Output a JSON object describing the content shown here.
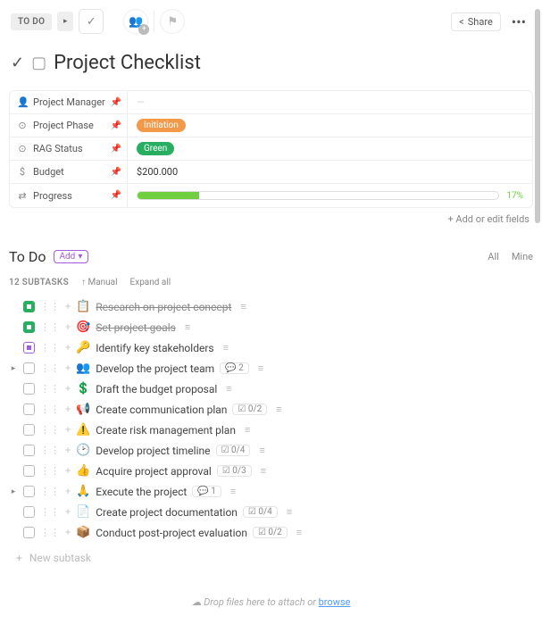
{
  "topbar": {
    "status": "TO DO",
    "share": "Share"
  },
  "page": {
    "title": "Project Checklist"
  },
  "fields": [
    {
      "icon": "👤",
      "label": "Project Manager",
      "kind": "empty",
      "value": ""
    },
    {
      "icon": "⊙",
      "label": "Project Phase",
      "kind": "tag",
      "tagClass": "orange",
      "value": "Initiation"
    },
    {
      "icon": "⊙",
      "label": "RAG Status",
      "kind": "tag",
      "tagClass": "green",
      "value": "Green"
    },
    {
      "icon": "$",
      "label": "Budget",
      "kind": "text",
      "value": "$200.000"
    },
    {
      "icon": "⇄",
      "label": "Progress",
      "kind": "progress",
      "value": 17
    }
  ],
  "addFields": "+ Add or edit fields",
  "section": {
    "title": "To Do",
    "add": "Add",
    "filters": {
      "all": "All",
      "mine": "Mine"
    }
  },
  "subtaskBar": {
    "count": "12 SUBTASKS",
    "manual": "Manual",
    "expand": "Expand all"
  },
  "tasks": [
    {
      "check": "done",
      "emoji": "📋",
      "title": "Research on project concept",
      "struck": true
    },
    {
      "check": "done",
      "emoji": "🎯",
      "title": "Set project goals",
      "struck": true
    },
    {
      "check": "purple",
      "emoji": "🔑",
      "title": "Identify key stakeholders"
    },
    {
      "check": "open",
      "emoji": "👥",
      "title": "Develop the project team",
      "children": true,
      "comments": 2
    },
    {
      "check": "open",
      "emoji": "💲",
      "title": "Draft the budget proposal"
    },
    {
      "check": "open",
      "emoji": "📢",
      "title": "Create communication plan",
      "sub": "0/2"
    },
    {
      "check": "open",
      "emoji": "⚠️",
      "title": "Create risk management plan"
    },
    {
      "check": "open",
      "emoji": "🕑",
      "title": "Develop project timeline",
      "sub": "0/4"
    },
    {
      "check": "open",
      "emoji": "👍",
      "title": "Acquire project approval",
      "sub": "0/3"
    },
    {
      "check": "open",
      "emoji": "🙏",
      "title": "Execute the project",
      "children": true,
      "comments": 1
    },
    {
      "check": "open",
      "emoji": "📄",
      "title": "Create project documentation",
      "sub": "0/4"
    },
    {
      "check": "open",
      "emoji": "📦",
      "title": "Conduct post-project evaluation",
      "sub": "0/2"
    }
  ],
  "newSubtask": "New subtask",
  "dropzone": {
    "text": "Drop files here to attach or ",
    "link": "browse"
  }
}
